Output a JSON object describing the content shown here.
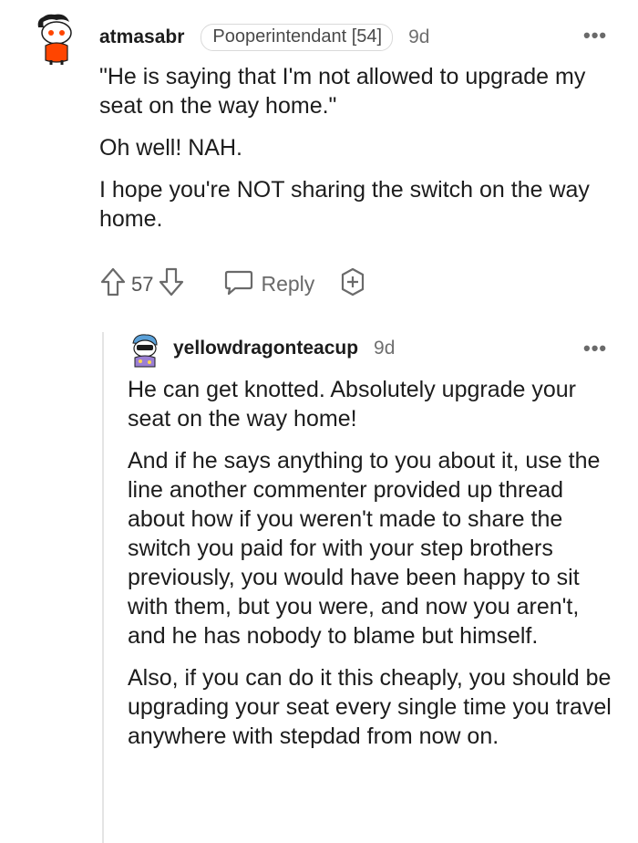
{
  "comment1": {
    "username": "atmasabr",
    "flair": "Pooperintendant [54]",
    "time": "9d",
    "paragraphs": [
      "\"He is saying that I'm not allowed to upgrade my seat on the way home.\"",
      "Oh well! NAH.",
      "I hope you're NOT sharing the switch on the way home."
    ],
    "upvotes": "57",
    "reply_label": "Reply"
  },
  "comment2": {
    "username": "yellowdragonteacup",
    "time": "9d",
    "paragraphs": [
      "He can get knotted. Absolutely upgrade your seat on the way home!",
      "And if he says anything to you about it, use the line another commenter provided up thread about how if you weren't made to share the switch you paid for with your step brothers previously, you would have been happy to sit with them, but you were, and now you aren't, and he has nobody to blame but himself.",
      "Also, if you can do it this cheaply, you should be upgrading your seat every single time you travel anywhere with stepdad from now on."
    ]
  },
  "colors": {
    "text": "#1c1c1c",
    "muted": "#6a6a6a",
    "avatar_orange": "#ff4500",
    "avatar2_blue": "#5aa0d8"
  },
  "icons": [
    "snoo-avatar-icon",
    "upvote-icon",
    "downvote-icon",
    "reply-icon",
    "award-icon",
    "more-icon"
  ]
}
